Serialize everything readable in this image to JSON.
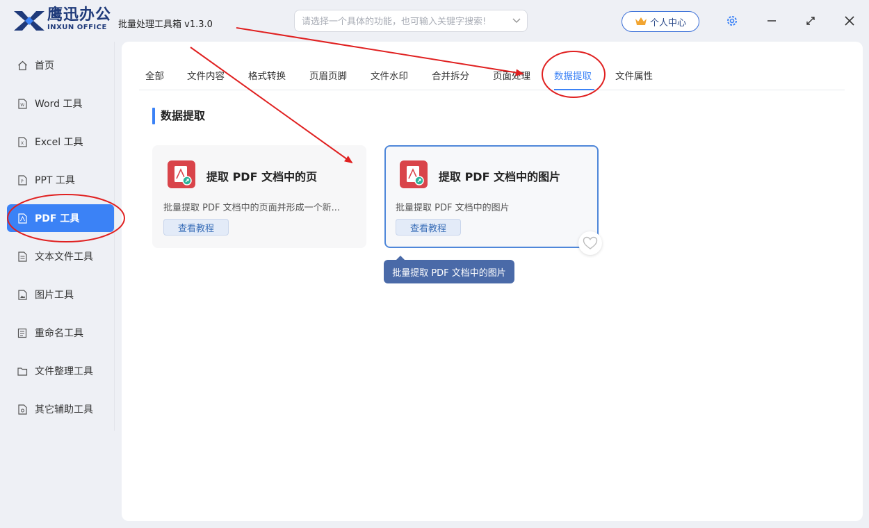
{
  "brand": {
    "name_cn": "鹰迅办公",
    "name_en": "INXUN OFFICE"
  },
  "app_title": "批量处理工具箱 v1.3.0",
  "search": {
    "placeholder": "请选择一个具体的功能，也可输入关键字搜索!",
    "value": ""
  },
  "user_center_label": "个人中心",
  "sidebar": {
    "items": [
      {
        "label": "首页",
        "icon": "home-icon"
      },
      {
        "label": "Word 工具",
        "icon": "word-file-icon"
      },
      {
        "label": "Excel 工具",
        "icon": "excel-file-icon"
      },
      {
        "label": "PPT 工具",
        "icon": "ppt-file-icon"
      },
      {
        "label": "PDF 工具",
        "icon": "pdf-file-icon",
        "active": true
      },
      {
        "label": "文本文件工具",
        "icon": "text-file-icon"
      },
      {
        "label": "图片工具",
        "icon": "image-file-icon"
      },
      {
        "label": "重命名工具",
        "icon": "rename-icon"
      },
      {
        "label": "文件整理工具",
        "icon": "folder-icon"
      },
      {
        "label": "其它辅助工具",
        "icon": "tools-file-icon"
      }
    ]
  },
  "tabs": [
    {
      "label": "全部"
    },
    {
      "label": "文件内容"
    },
    {
      "label": "格式转换"
    },
    {
      "label": "页眉页脚"
    },
    {
      "label": "文件水印"
    },
    {
      "label": "合并拆分"
    },
    {
      "label": "页面处理"
    },
    {
      "label": "数据提取",
      "active": true
    },
    {
      "label": "文件属性"
    }
  ],
  "section_title": "数据提取",
  "cards": [
    {
      "title": "提取 PDF 文档中的页",
      "description": "批量提取 PDF 文档中的页面并形成一个新...",
      "button": "查看教程",
      "icon": "pdf-extract-icon"
    },
    {
      "title": "提取 PDF 文档中的图片",
      "description": "批量提取 PDF 文档中的图片",
      "button": "查看教程",
      "icon": "pdf-extract-icon",
      "selected": true
    }
  ],
  "tooltip": "批量提取 PDF 文档中的图片",
  "colors": {
    "accent": "#3b82f6",
    "brand_navy": "#1f3a7a",
    "pdf_red": "#d9444a",
    "annotation_red": "#e02020",
    "tooltip_bg": "#4a6aa8"
  }
}
